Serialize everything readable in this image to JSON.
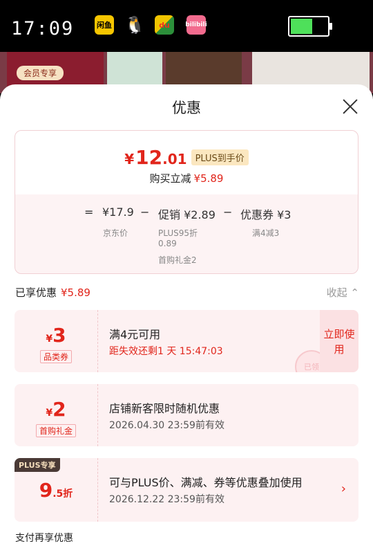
{
  "status_bar": {
    "time": "17:09",
    "apps": [
      {
        "name": "xianyu-app-icon",
        "label": "闲鱼"
      },
      {
        "name": "qq-app-icon",
        "label": "🐧"
      },
      {
        "name": "dewu-app-icon",
        "label": "du"
      },
      {
        "name": "bilibili-app-icon",
        "label": "bilibili"
      }
    ],
    "battery_level": 0.6,
    "battery_color": "#4ee05a"
  },
  "background_page": {
    "member_tag": "会员专享"
  },
  "sheet": {
    "title": "优惠",
    "summary": {
      "yen": "¥",
      "price_int": "12",
      "price_dec": ".01",
      "plus_label": "PLUS到手价",
      "instant_label": "购买立减",
      "instant_value": "¥5.89",
      "eq": "=",
      "jd_price": "¥17.9",
      "jd_price_label": "京东价",
      "minus1": "−",
      "promo": "促销 ¥2.89",
      "promo_note1": "PLUS95折",
      "promo_note2": "0.89",
      "promo_note3": "首购礼金2",
      "minus2": "−",
      "coupon": "优惠券 ¥3",
      "coupon_note": "满4减3"
    },
    "enjoyed_label": "已享优惠",
    "enjoyed_value": "¥5.89",
    "collapse_label": "收起",
    "coupons": [
      {
        "yen": "¥",
        "amount": "3",
        "kind": "品类券",
        "title": "满4元可用",
        "subtitle": "距失效还剩1 天 15:47:03",
        "action": "立即使用",
        "stamp": "已领"
      },
      {
        "yen": "¥",
        "amount": "2",
        "kind": "首购礼金",
        "title": "店铺新客限时随机优惠",
        "subtitle": "2026.04.30 23:59前有效"
      },
      {
        "badge": "PLUS专享",
        "amount": "9",
        "amount_dec": ".5折",
        "title": "可与PLUS价、满减、券等优惠叠加使用",
        "subtitle": "2026.12.22 23:59前有效",
        "arrow": "›"
      }
    ],
    "pay_more": "支付再享优惠"
  },
  "colors": {
    "accent": "#e1251b",
    "card_bg": "#fdf1f2"
  }
}
